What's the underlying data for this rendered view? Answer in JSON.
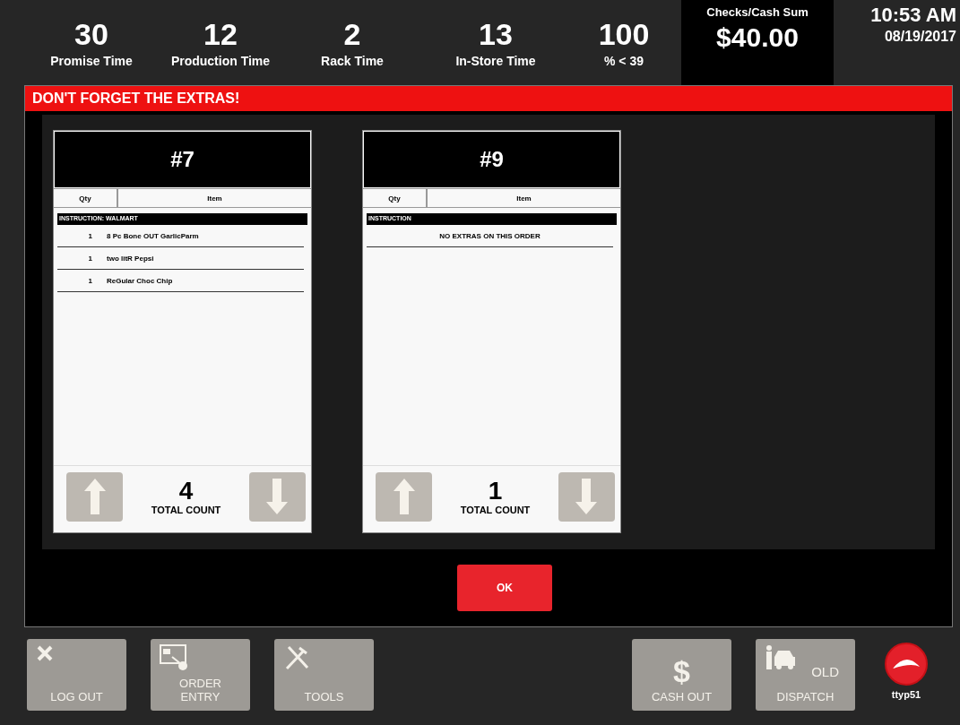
{
  "header": {
    "metrics": [
      {
        "value": "30",
        "label": "Promise Time"
      },
      {
        "value": "12",
        "label": "Production Time"
      },
      {
        "value": "2",
        "label": "Rack Time"
      },
      {
        "value": "13",
        "label": "In-Store Time"
      },
      {
        "value": "100",
        "label": "% < 39"
      }
    ],
    "cash_sum": {
      "label": "Checks/Cash Sum",
      "value": "$40.00"
    },
    "clock": {
      "time": "10:53 AM",
      "date": "08/19/2017"
    }
  },
  "dialog": {
    "title": "DON'T FORGET THE EXTRAS!",
    "orders": [
      {
        "number": "#7",
        "columns": [
          "Qty",
          "Item"
        ],
        "lines": [
          {
            "kind": "instruction",
            "text": "INSTRUCTION: WALMART"
          },
          {
            "kind": "item",
            "qty": "1",
            "item": "8 Pc Bone OUT  GarlicParm"
          },
          {
            "kind": "item",
            "qty": "1",
            "item": "two litR  Pepsi"
          },
          {
            "kind": "item",
            "qty": "1",
            "item": "ReGular  Choc Chip"
          }
        ],
        "total": "4",
        "total_label": "TOTAL COUNT"
      },
      {
        "number": "#9",
        "columns": [
          "Qty",
          "Item"
        ],
        "lines": [
          {
            "kind": "instruction",
            "text": "INSTRUCTION"
          },
          {
            "kind": "message",
            "text": "NO EXTRAS ON THIS ORDER"
          }
        ],
        "total": "1",
        "total_label": "TOTAL COUNT"
      }
    ],
    "ok_button": "OK"
  },
  "toolbar": {
    "buttons": [
      {
        "kind": "logout",
        "label": "LOG OUT"
      },
      {
        "kind": "order",
        "label": "ORDER ENTRY"
      },
      {
        "kind": "tools",
        "label": "TOOLS"
      },
      {
        "kind": "spacer"
      },
      {
        "kind": "cash",
        "symbol": "$",
        "label": "CASH OUT"
      },
      {
        "kind": "dispatch",
        "tag": "OLD",
        "label": "DISPATCH"
      }
    ],
    "terminal": "ttyp51"
  }
}
